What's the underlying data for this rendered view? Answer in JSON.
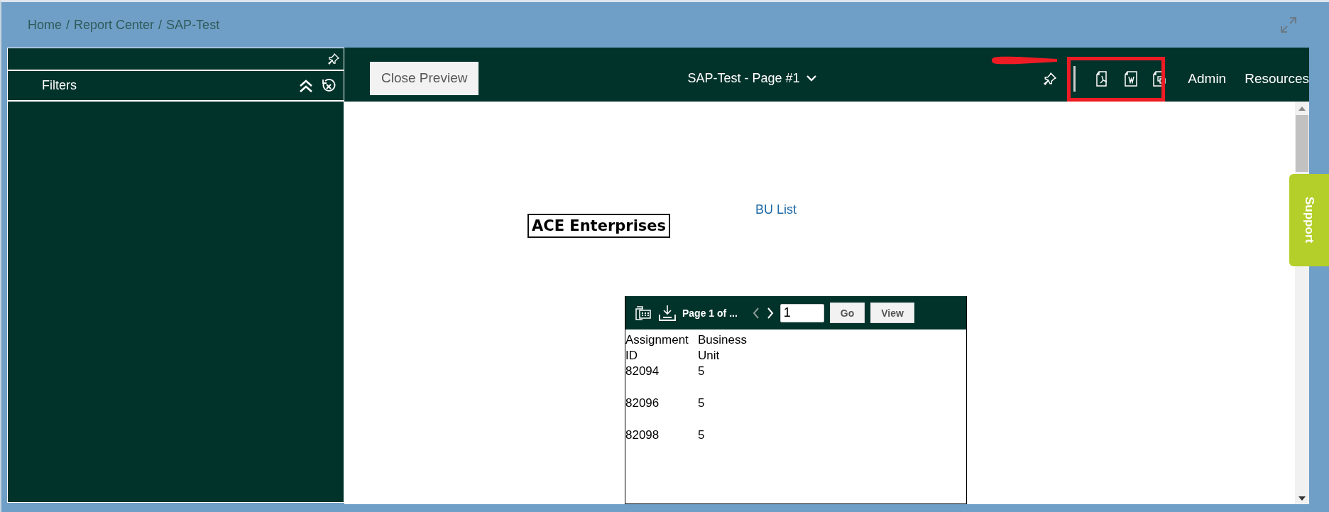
{
  "breadcrumb": {
    "separator": "/",
    "items": [
      {
        "label": "Home"
      },
      {
        "label": "Report Center"
      },
      {
        "label": "SAP-Test"
      }
    ]
  },
  "filters_panel": {
    "title": "Filters"
  },
  "toolbar": {
    "close_button": "Close Preview",
    "page_title": "SAP-Test - Page #1",
    "menu": [
      {
        "label": "Admin"
      },
      {
        "label": "Resources"
      }
    ]
  },
  "report": {
    "company": "ACE Enterprises",
    "title": "BU List",
    "viewer": {
      "page_label": "Page 1 of ...",
      "page_input": "1",
      "go": "Go",
      "view": "View"
    },
    "table": {
      "columns": [
        "Assignment ID",
        "Business Unit"
      ],
      "rows": [
        [
          "82094",
          "5"
        ],
        [
          "82096",
          "5"
        ],
        [
          "82098",
          "5"
        ]
      ]
    }
  },
  "support_tab": "Support"
}
